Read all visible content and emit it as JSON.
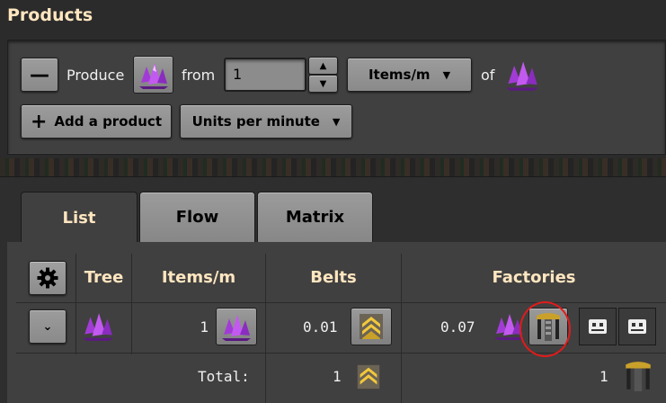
{
  "products": {
    "title": "Products",
    "row1": {
      "remove_label": "—",
      "produce_label": "Produce",
      "from_label": "from",
      "quantity_value": "1",
      "rate_unit": "Items/m",
      "of_label": "of",
      "item_icon": "purple-crystal-icon"
    },
    "row2": {
      "add_product_label": "Add a product",
      "units_label": "Units per minute"
    }
  },
  "tabs": [
    {
      "label": "List",
      "active": true
    },
    {
      "label": "Flow",
      "active": false
    },
    {
      "label": "Matrix",
      "active": false
    }
  ],
  "table": {
    "headers": {
      "tree": "Tree",
      "items": "Items/m",
      "belts": "Belts",
      "factories": "Factories"
    },
    "row": {
      "items_value": "1",
      "belts_value": "0.01",
      "factories_value": "0.07"
    },
    "total": {
      "label": "Total:",
      "belts_value": "1",
      "factories_value": "1"
    }
  },
  "colors": {
    "accent_header": "#ffe6c0",
    "panel": "#414040",
    "highlight": "#e21b1b"
  }
}
